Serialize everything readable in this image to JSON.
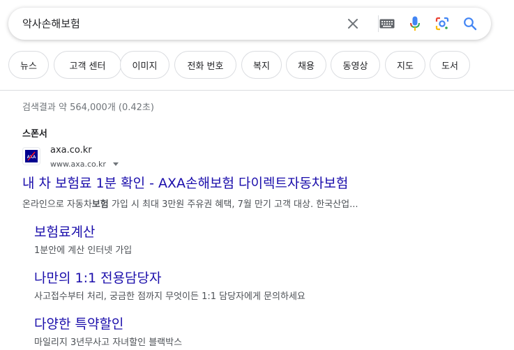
{
  "search": {
    "query": "악사손해보험",
    "clear_icon": "close-icon",
    "keyboard_icon": "keyboard-icon",
    "voice_icon": "microphone-icon",
    "lens_icon": "google-lens-icon",
    "search_icon": "search-icon"
  },
  "chips": [
    {
      "label": "뉴스"
    },
    {
      "label": "고객 센터"
    },
    {
      "label": "이미지"
    },
    {
      "label": "전화 번호"
    },
    {
      "label": "복지"
    },
    {
      "label": "채용"
    },
    {
      "label": "동영상"
    },
    {
      "label": "지도"
    },
    {
      "label": "도서"
    }
  ],
  "results": {
    "stats": "검색결과 약 564,000개 (0.42초)",
    "sponsor_label": "스폰서",
    "ad": {
      "domain": "axa.co.kr",
      "url": "www.axa.co.kr",
      "title": "내 차 보험료 1분 확인 - AXA손해보험 다이렉트자동차보험",
      "desc_pre": "온라인으로 자동차",
      "desc_bold": "보험",
      "desc_post": " 가입 시 최대 3만원 주유권 혜택, 7월 만기 고객 대상. 한국산업...",
      "favicon_text": "AXA"
    },
    "sitelinks": [
      {
        "title": "보험료계산",
        "desc": "1분안에 계산 인터넷 가입"
      },
      {
        "title": "나만의 1:1 전용담당자",
        "desc": "사고접수부터 처리, 궁금한 점까지 무엇이든 1:1 담당자에게 문의하세요"
      },
      {
        "title": "다양한 특약할인",
        "desc": "마일리지 3년무사고 자녀할인 블랙박스"
      }
    ]
  },
  "colors": {
    "link": "#1a0dab",
    "snippet": "#4d5156",
    "meta": "#70757a",
    "axa_blue": "#00008f",
    "axa_red": "#ff1721"
  }
}
